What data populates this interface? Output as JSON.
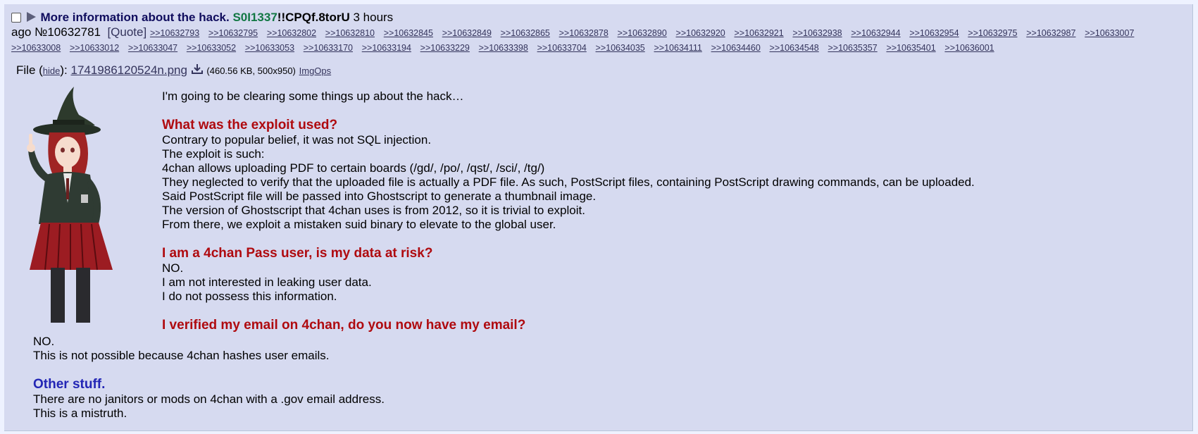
{
  "post": {
    "subject": "More information about the hack.",
    "name": "S0I1337",
    "tripcode": "!!CPQf.8torU",
    "time_a": "3 hours",
    "time_b": "ago",
    "number": "№10632781",
    "quote": "[Quote]",
    "backlinks": [
      ">>10632793",
      ">>10632795",
      ">>10632802",
      ">>10632810",
      ">>10632845",
      ">>10632849",
      ">>10632865",
      ">>10632878",
      ">>10632890",
      ">>10632920",
      ">>10632921",
      ">>10632938",
      ">>10632944",
      ">>10632954",
      ">>10632975",
      ">>10632987",
      ">>10633007",
      ">>10633008",
      ">>10633012",
      ">>10633047",
      ">>10633052",
      ">>10633053",
      ">>10633170",
      ">>10633194",
      ">>10633229",
      ">>10633398",
      ">>10633704",
      ">>10634035",
      ">>10634111",
      ">>10634460",
      ">>10634548",
      ">>10635357",
      ">>10635401",
      ">>10636001"
    ],
    "file": {
      "label": "File (",
      "hide": "hide",
      "after_hide": "):",
      "filename": "1741986120524n.png",
      "icon": "download-icon",
      "info": "(460.56 KB, 500x950)",
      "imgops": "ImgOps"
    },
    "body": {
      "intro": "I'm going to be clearing some things up about the hack…",
      "h1": "What was the exploit used?",
      "p1": [
        "Contrary to popular belief, it was not SQL injection.",
        "The exploit is such:",
        "4chan allows uploading PDF to certain boards (/gd/, /po/, /qst/, /sci/, /tg/)",
        "They neglected to verify that the uploaded file is actually a PDF file. As such, PostScript files, containing PostScript drawing commands, can be uploaded.",
        "Said PostScript file will be passed into Ghostscript to generate a thumbnail image.",
        "The version of Ghostscript that 4chan uses is from 2012, so it is trivial to exploit.",
        "From there, we exploit a mistaken suid binary to elevate to the global user."
      ],
      "h2": "I am a 4chan Pass user, is my data at risk?",
      "p2": [
        "NO.",
        "I am not interested in leaking user data.",
        "I do not possess this information."
      ],
      "h3": "I verified my email on 4chan, do you now have my email?",
      "p3": [
        "NO.",
        "This is not possible because 4chan hashes user emails."
      ],
      "h4": "Other stuff.",
      "p4": [
        "There are no janitors or mods on 4chan with a .gov email address.",
        "This is a mistruth."
      ]
    }
  },
  "colors": {
    "post_bg": "#d6daf0",
    "subject": "#0f0c5d",
    "name": "#117743",
    "heading_red": "#af0a0f",
    "heading_blue": "#2326b5",
    "link": "#34345c"
  }
}
